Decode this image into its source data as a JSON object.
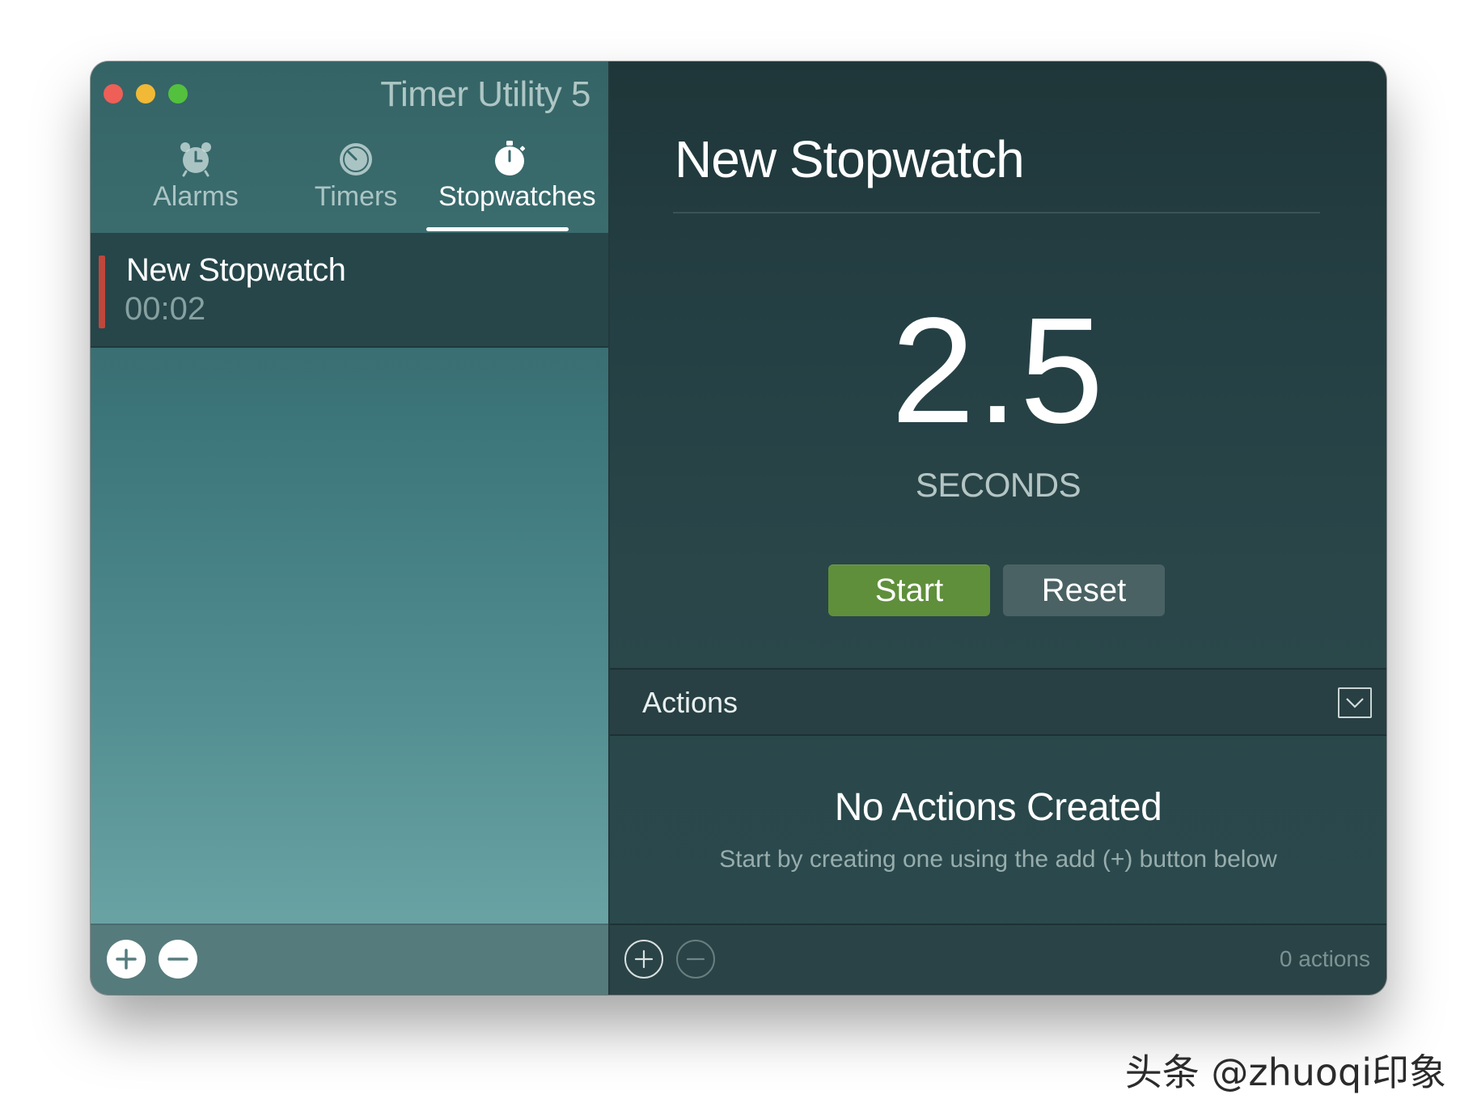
{
  "window": {
    "app_title": "Timer Utility 5"
  },
  "sidebar": {
    "tabs": [
      {
        "label": "Alarms",
        "icon": "alarm-clock-icon",
        "active": false
      },
      {
        "label": "Timers",
        "icon": "timer-icon",
        "active": false
      },
      {
        "label": "Stopwatches",
        "icon": "stopwatch-icon",
        "active": true
      }
    ],
    "items": [
      {
        "name": "New Stopwatch",
        "time": "00:02",
        "marker_color": "#c0473b"
      }
    ]
  },
  "main": {
    "title": "New Stopwatch",
    "value": "2.5",
    "unit": "SECONDS",
    "start_label": "Start",
    "reset_label": "Reset",
    "actions": {
      "header": "Actions",
      "empty_title": "No Actions Created",
      "empty_subtitle": "Start by creating one using the add (+) button below",
      "count_label": "0 actions"
    }
  },
  "colors": {
    "start_button": "#5f8f3a",
    "reset_button": "#4a6264",
    "close": "#ee5f57",
    "minimize": "#f1b935",
    "maximize": "#53c13d"
  },
  "watermark": "头条 @zhuoqi印象"
}
